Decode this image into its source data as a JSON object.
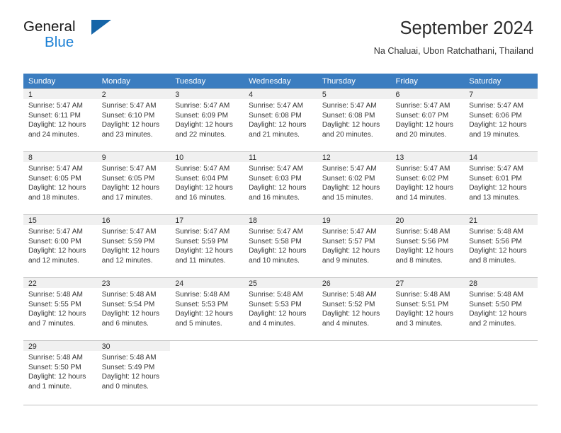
{
  "brand": {
    "line1": "General",
    "line2": "Blue",
    "triangle_color": "#1565a8",
    "blue_color": "#1a7fd4"
  },
  "header": {
    "title": "September 2024",
    "location": "Na Chaluai, Ubon Ratchathani, Thailand"
  },
  "theme": {
    "header_bg": "#3b7dc0",
    "daynum_bg": "#f0f0f0",
    "grid_line": "#bfbfbf",
    "text": "#333333"
  },
  "weekdays": [
    "Sunday",
    "Monday",
    "Tuesday",
    "Wednesday",
    "Thursday",
    "Friday",
    "Saturday"
  ],
  "labels": {
    "sunrise_prefix": "Sunrise:",
    "sunset_prefix": "Sunset:",
    "daylight_prefix": "Daylight:"
  },
  "days": [
    {
      "day": "1",
      "sunrise": "Sunrise: 5:47 AM",
      "sunset": "Sunset: 6:11 PM",
      "daylight_l1": "Daylight: 12 hours",
      "daylight_l2": "and 24 minutes."
    },
    {
      "day": "2",
      "sunrise": "Sunrise: 5:47 AM",
      "sunset": "Sunset: 6:10 PM",
      "daylight_l1": "Daylight: 12 hours",
      "daylight_l2": "and 23 minutes."
    },
    {
      "day": "3",
      "sunrise": "Sunrise: 5:47 AM",
      "sunset": "Sunset: 6:09 PM",
      "daylight_l1": "Daylight: 12 hours",
      "daylight_l2": "and 22 minutes."
    },
    {
      "day": "4",
      "sunrise": "Sunrise: 5:47 AM",
      "sunset": "Sunset: 6:08 PM",
      "daylight_l1": "Daylight: 12 hours",
      "daylight_l2": "and 21 minutes."
    },
    {
      "day": "5",
      "sunrise": "Sunrise: 5:47 AM",
      "sunset": "Sunset: 6:08 PM",
      "daylight_l1": "Daylight: 12 hours",
      "daylight_l2": "and 20 minutes."
    },
    {
      "day": "6",
      "sunrise": "Sunrise: 5:47 AM",
      "sunset": "Sunset: 6:07 PM",
      "daylight_l1": "Daylight: 12 hours",
      "daylight_l2": "and 20 minutes."
    },
    {
      "day": "7",
      "sunrise": "Sunrise: 5:47 AM",
      "sunset": "Sunset: 6:06 PM",
      "daylight_l1": "Daylight: 12 hours",
      "daylight_l2": "and 19 minutes."
    },
    {
      "day": "8",
      "sunrise": "Sunrise: 5:47 AM",
      "sunset": "Sunset: 6:05 PM",
      "daylight_l1": "Daylight: 12 hours",
      "daylight_l2": "and 18 minutes."
    },
    {
      "day": "9",
      "sunrise": "Sunrise: 5:47 AM",
      "sunset": "Sunset: 6:05 PM",
      "daylight_l1": "Daylight: 12 hours",
      "daylight_l2": "and 17 minutes."
    },
    {
      "day": "10",
      "sunrise": "Sunrise: 5:47 AM",
      "sunset": "Sunset: 6:04 PM",
      "daylight_l1": "Daylight: 12 hours",
      "daylight_l2": "and 16 minutes."
    },
    {
      "day": "11",
      "sunrise": "Sunrise: 5:47 AM",
      "sunset": "Sunset: 6:03 PM",
      "daylight_l1": "Daylight: 12 hours",
      "daylight_l2": "and 16 minutes."
    },
    {
      "day": "12",
      "sunrise": "Sunrise: 5:47 AM",
      "sunset": "Sunset: 6:02 PM",
      "daylight_l1": "Daylight: 12 hours",
      "daylight_l2": "and 15 minutes."
    },
    {
      "day": "13",
      "sunrise": "Sunrise: 5:47 AM",
      "sunset": "Sunset: 6:02 PM",
      "daylight_l1": "Daylight: 12 hours",
      "daylight_l2": "and 14 minutes."
    },
    {
      "day": "14",
      "sunrise": "Sunrise: 5:47 AM",
      "sunset": "Sunset: 6:01 PM",
      "daylight_l1": "Daylight: 12 hours",
      "daylight_l2": "and 13 minutes."
    },
    {
      "day": "15",
      "sunrise": "Sunrise: 5:47 AM",
      "sunset": "Sunset: 6:00 PM",
      "daylight_l1": "Daylight: 12 hours",
      "daylight_l2": "and 12 minutes."
    },
    {
      "day": "16",
      "sunrise": "Sunrise: 5:47 AM",
      "sunset": "Sunset: 5:59 PM",
      "daylight_l1": "Daylight: 12 hours",
      "daylight_l2": "and 12 minutes."
    },
    {
      "day": "17",
      "sunrise": "Sunrise: 5:47 AM",
      "sunset": "Sunset: 5:59 PM",
      "daylight_l1": "Daylight: 12 hours",
      "daylight_l2": "and 11 minutes."
    },
    {
      "day": "18",
      "sunrise": "Sunrise: 5:47 AM",
      "sunset": "Sunset: 5:58 PM",
      "daylight_l1": "Daylight: 12 hours",
      "daylight_l2": "and 10 minutes."
    },
    {
      "day": "19",
      "sunrise": "Sunrise: 5:47 AM",
      "sunset": "Sunset: 5:57 PM",
      "daylight_l1": "Daylight: 12 hours",
      "daylight_l2": "and 9 minutes."
    },
    {
      "day": "20",
      "sunrise": "Sunrise: 5:48 AM",
      "sunset": "Sunset: 5:56 PM",
      "daylight_l1": "Daylight: 12 hours",
      "daylight_l2": "and 8 minutes."
    },
    {
      "day": "21",
      "sunrise": "Sunrise: 5:48 AM",
      "sunset": "Sunset: 5:56 PM",
      "daylight_l1": "Daylight: 12 hours",
      "daylight_l2": "and 8 minutes."
    },
    {
      "day": "22",
      "sunrise": "Sunrise: 5:48 AM",
      "sunset": "Sunset: 5:55 PM",
      "daylight_l1": "Daylight: 12 hours",
      "daylight_l2": "and 7 minutes."
    },
    {
      "day": "23",
      "sunrise": "Sunrise: 5:48 AM",
      "sunset": "Sunset: 5:54 PM",
      "daylight_l1": "Daylight: 12 hours",
      "daylight_l2": "and 6 minutes."
    },
    {
      "day": "24",
      "sunrise": "Sunrise: 5:48 AM",
      "sunset": "Sunset: 5:53 PM",
      "daylight_l1": "Daylight: 12 hours",
      "daylight_l2": "and 5 minutes."
    },
    {
      "day": "25",
      "sunrise": "Sunrise: 5:48 AM",
      "sunset": "Sunset: 5:53 PM",
      "daylight_l1": "Daylight: 12 hours",
      "daylight_l2": "and 4 minutes."
    },
    {
      "day": "26",
      "sunrise": "Sunrise: 5:48 AM",
      "sunset": "Sunset: 5:52 PM",
      "daylight_l1": "Daylight: 12 hours",
      "daylight_l2": "and 4 minutes."
    },
    {
      "day": "27",
      "sunrise": "Sunrise: 5:48 AM",
      "sunset": "Sunset: 5:51 PM",
      "daylight_l1": "Daylight: 12 hours",
      "daylight_l2": "and 3 minutes."
    },
    {
      "day": "28",
      "sunrise": "Sunrise: 5:48 AM",
      "sunset": "Sunset: 5:50 PM",
      "daylight_l1": "Daylight: 12 hours",
      "daylight_l2": "and 2 minutes."
    },
    {
      "day": "29",
      "sunrise": "Sunrise: 5:48 AM",
      "sunset": "Sunset: 5:50 PM",
      "daylight_l1": "Daylight: 12 hours",
      "daylight_l2": "and 1 minute."
    },
    {
      "day": "30",
      "sunrise": "Sunrise: 5:48 AM",
      "sunset": "Sunset: 5:49 PM",
      "daylight_l1": "Daylight: 12 hours",
      "daylight_l2": "and 0 minutes."
    }
  ],
  "grid": {
    "first_day_column_index": 0,
    "num_weeks": 5
  }
}
